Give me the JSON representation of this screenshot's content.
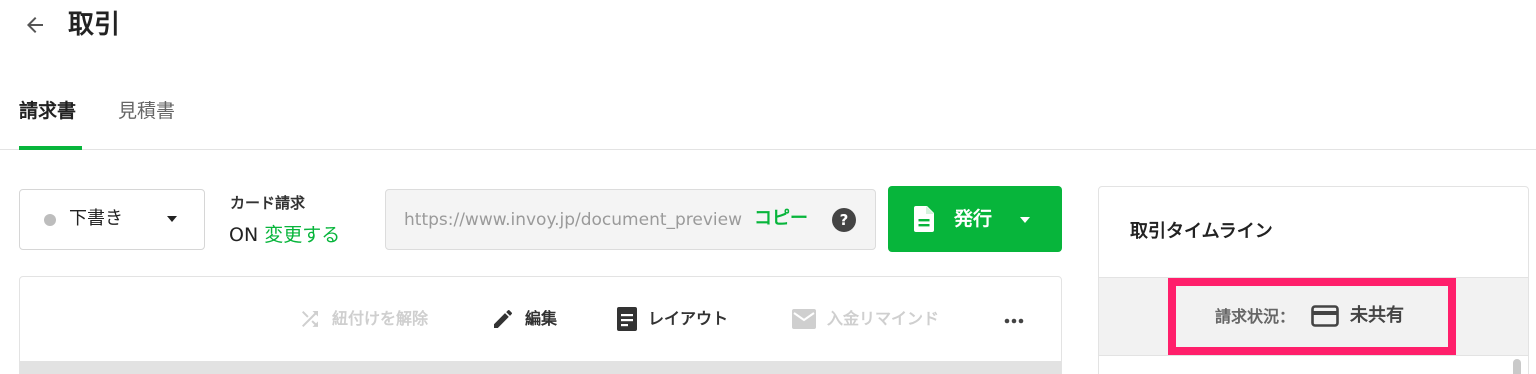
{
  "header": {
    "back_icon": "arrow-left-icon",
    "title": "取引"
  },
  "tabs": [
    {
      "label": "請求書",
      "active": true
    },
    {
      "label": "見積書",
      "active": false
    }
  ],
  "status_select": {
    "value": "下書き",
    "dot_color": "#bdbdbd"
  },
  "card_billing": {
    "title": "カード請求",
    "state": "ON",
    "change_link": "変更する"
  },
  "share_url": {
    "value": "https://www.invoy.jp/document_preview",
    "copy_label": "コピー",
    "help_icon": "question-circle-icon"
  },
  "issue_button": {
    "label": "発行",
    "icon": "document-icon",
    "color": "#07b53b"
  },
  "toolbar": {
    "unlink": {
      "label": "紐付けを解除",
      "icon": "shuffle-icon",
      "enabled": false
    },
    "edit": {
      "label": "編集",
      "icon": "pencil-icon",
      "enabled": true
    },
    "layout": {
      "label": "レイアウト",
      "icon": "document-lines-icon",
      "enabled": true
    },
    "remind": {
      "label": "入金リマインド",
      "icon": "mail-icon",
      "enabled": false
    },
    "more_icon": "more-horizontal-icon"
  },
  "timeline": {
    "title": "取引タイムライン",
    "status_caption": "請求状況：",
    "status_icon": "credit-card-icon",
    "status_value": "未共有"
  },
  "colors": {
    "accent": "#07b53b",
    "highlight": "#ff1f6b"
  }
}
